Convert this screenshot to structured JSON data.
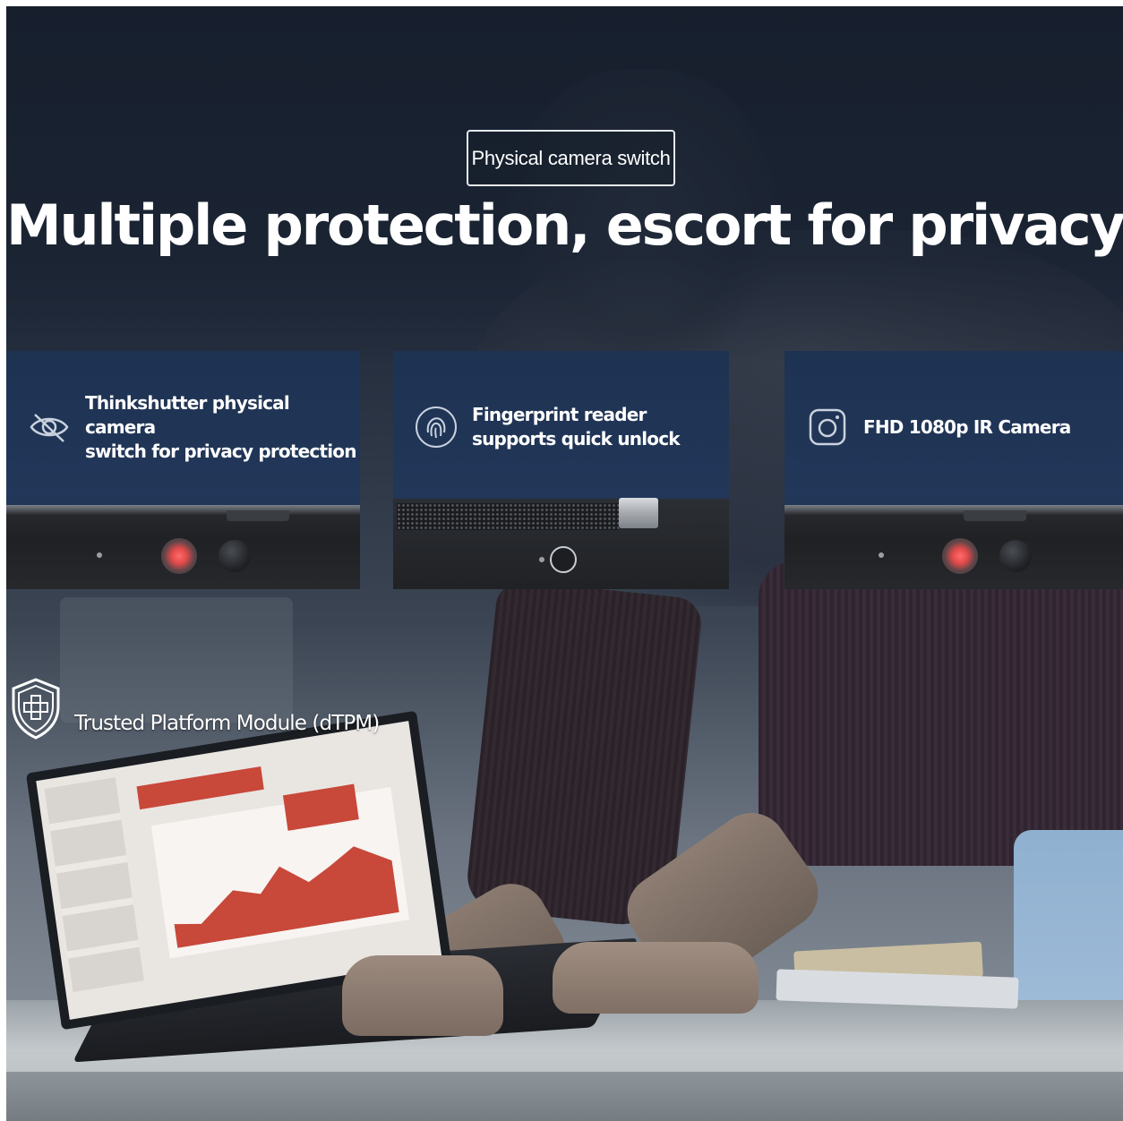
{
  "tag": "Physical camera switch",
  "headline": "Multiple protection, escort for privacy",
  "features": [
    {
      "icon": "eye-slash-icon",
      "line1": "Thinkshutter physical camera",
      "line2": "switch for privacy protection"
    },
    {
      "icon": "fingerprint-icon",
      "line1": "Fingerprint reader",
      "line2": "supports quick unlock"
    },
    {
      "icon": "camera-icon",
      "line1": "FHD 1080p IR Camera",
      "line2": ""
    }
  ],
  "tpm": {
    "icon": "shield-plus-icon",
    "label": "Trusted Platform Module (dTPM)"
  },
  "colors": {
    "panel": "#1e3252",
    "text": "#ffffff",
    "camera_red": "#e24a4a"
  }
}
